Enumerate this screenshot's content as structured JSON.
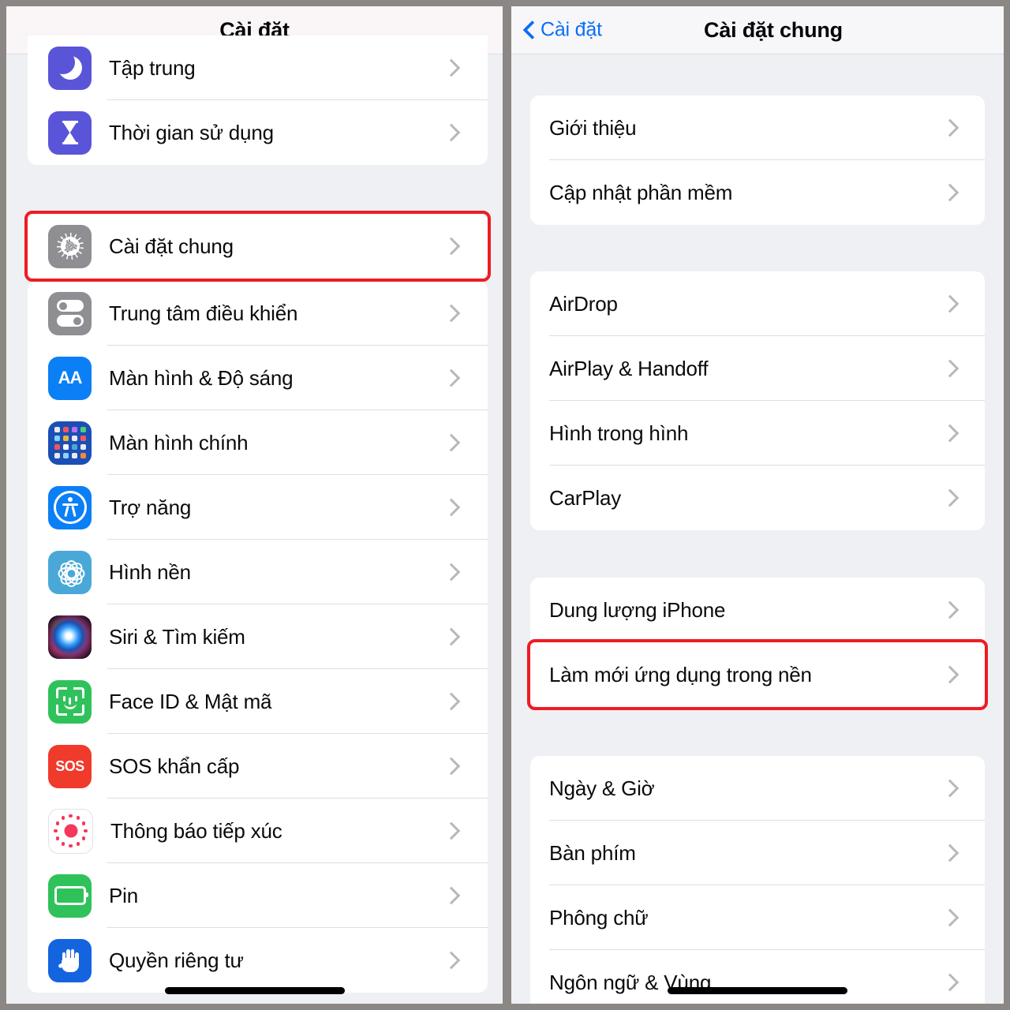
{
  "left_panel": {
    "nav_title": "Cài đặt",
    "groups": [
      {
        "id": "group-focus",
        "rows": [
          {
            "label": "Tập trung",
            "icon": "moon-icon"
          },
          {
            "label": "Thời gian sử dụng",
            "icon": "hourglass-icon"
          }
        ]
      },
      {
        "id": "group-general",
        "highlighted": true,
        "rows": [
          {
            "label": "Cài đặt chung",
            "icon": "gear-icon"
          }
        ]
      },
      {
        "id": "group-system",
        "rows": [
          {
            "label": "Trung tâm điều khiển",
            "icon": "control-center-icon"
          },
          {
            "label": "Màn hình & Độ sáng",
            "icon": "display-brightness-icon"
          },
          {
            "label": "Màn hình chính",
            "icon": "home-screen-icon"
          },
          {
            "label": "Trợ năng",
            "icon": "accessibility-icon"
          },
          {
            "label": "Hình nền",
            "icon": "wallpaper-icon"
          },
          {
            "label": "Siri & Tìm kiếm",
            "icon": "siri-icon"
          },
          {
            "label": "Face ID & Mật mã",
            "icon": "face-id-icon"
          },
          {
            "label": "SOS khẩn cấp",
            "icon": "sos-icon"
          },
          {
            "label": "Thông báo tiếp xúc",
            "icon": "exposure-notification-icon"
          },
          {
            "label": "Pin",
            "icon": "battery-icon"
          },
          {
            "label": "Quyền riêng tư",
            "icon": "privacy-hand-icon"
          }
        ]
      }
    ]
  },
  "right_panel": {
    "back_label": "Cài đặt",
    "nav_title": "Cài đặt chung",
    "groups": [
      {
        "id": "group-about",
        "rows": [
          {
            "label": "Giới thiệu"
          },
          {
            "label": "Cập nhật phần mềm"
          }
        ]
      },
      {
        "id": "group-connectivity",
        "rows": [
          {
            "label": "AirDrop"
          },
          {
            "label": "AirPlay & Handoff"
          },
          {
            "label": "Hình trong hình"
          },
          {
            "label": "CarPlay"
          }
        ]
      },
      {
        "id": "group-storage",
        "rows": [
          {
            "label": "Dung lượng iPhone"
          },
          {
            "label": "Làm mới ứng dụng trong nền",
            "highlighted": true
          }
        ]
      },
      {
        "id": "group-locale",
        "rows": [
          {
            "label": "Ngày & Giờ"
          },
          {
            "label": "Bàn phím"
          },
          {
            "label": "Phông chữ"
          },
          {
            "label": "Ngôn ngữ & Vùng"
          }
        ]
      }
    ]
  },
  "colors": {
    "highlight": "#ed1c24",
    "tint_blue": "#0b6ef5",
    "page_bg": "#eff0f4",
    "card_bg": "#ffffff",
    "frame": "#8b8785"
  }
}
